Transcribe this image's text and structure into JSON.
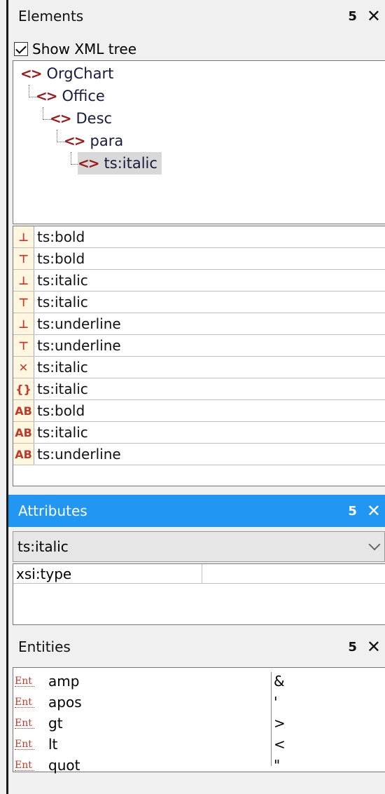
{
  "elements_panel": {
    "title": "Elements",
    "pin_icon": "pin",
    "close_icon": "close",
    "show_tree_label": "Show XML tree",
    "tree": [
      {
        "label": "OrgChart",
        "icon": "<>"
      },
      {
        "label": "Office",
        "icon": "<>"
      },
      {
        "label": "Desc",
        "icon": "<>"
      },
      {
        "label": "para",
        "icon": "<>"
      },
      {
        "label": "ts:italic",
        "icon": "<>"
      }
    ],
    "list": [
      {
        "label": "ts:bold",
        "icon": "insert-before-icon"
      },
      {
        "label": "ts:bold",
        "icon": "insert-after-icon"
      },
      {
        "label": "ts:italic",
        "icon": "insert-before-icon"
      },
      {
        "label": "ts:italic",
        "icon": "insert-after-icon"
      },
      {
        "label": "ts:underline",
        "icon": "insert-before-icon"
      },
      {
        "label": "ts:underline",
        "icon": "insert-after-icon"
      },
      {
        "label": "ts:italic",
        "icon": "remove-icon"
      },
      {
        "label": "ts:italic",
        "icon": "surround-icon"
      },
      {
        "label": "ts:bold",
        "icon": "apply-icon"
      },
      {
        "label": "ts:italic",
        "icon": "apply-icon"
      },
      {
        "label": "ts:underline",
        "icon": "apply-icon"
      }
    ]
  },
  "attributes_panel": {
    "title": "Attributes",
    "selected": "ts:italic",
    "rows": [
      {
        "name": "xsi:type",
        "value": ""
      }
    ]
  },
  "entities_panel": {
    "title": "Entities",
    "icon_label": "Ent",
    "rows": [
      {
        "name": "amp",
        "value": "&"
      },
      {
        "name": "apos",
        "value": "'"
      },
      {
        "name": "gt",
        "value": ">"
      },
      {
        "name": "lt",
        "value": "<"
      },
      {
        "name": "quot",
        "value": "\""
      }
    ]
  }
}
